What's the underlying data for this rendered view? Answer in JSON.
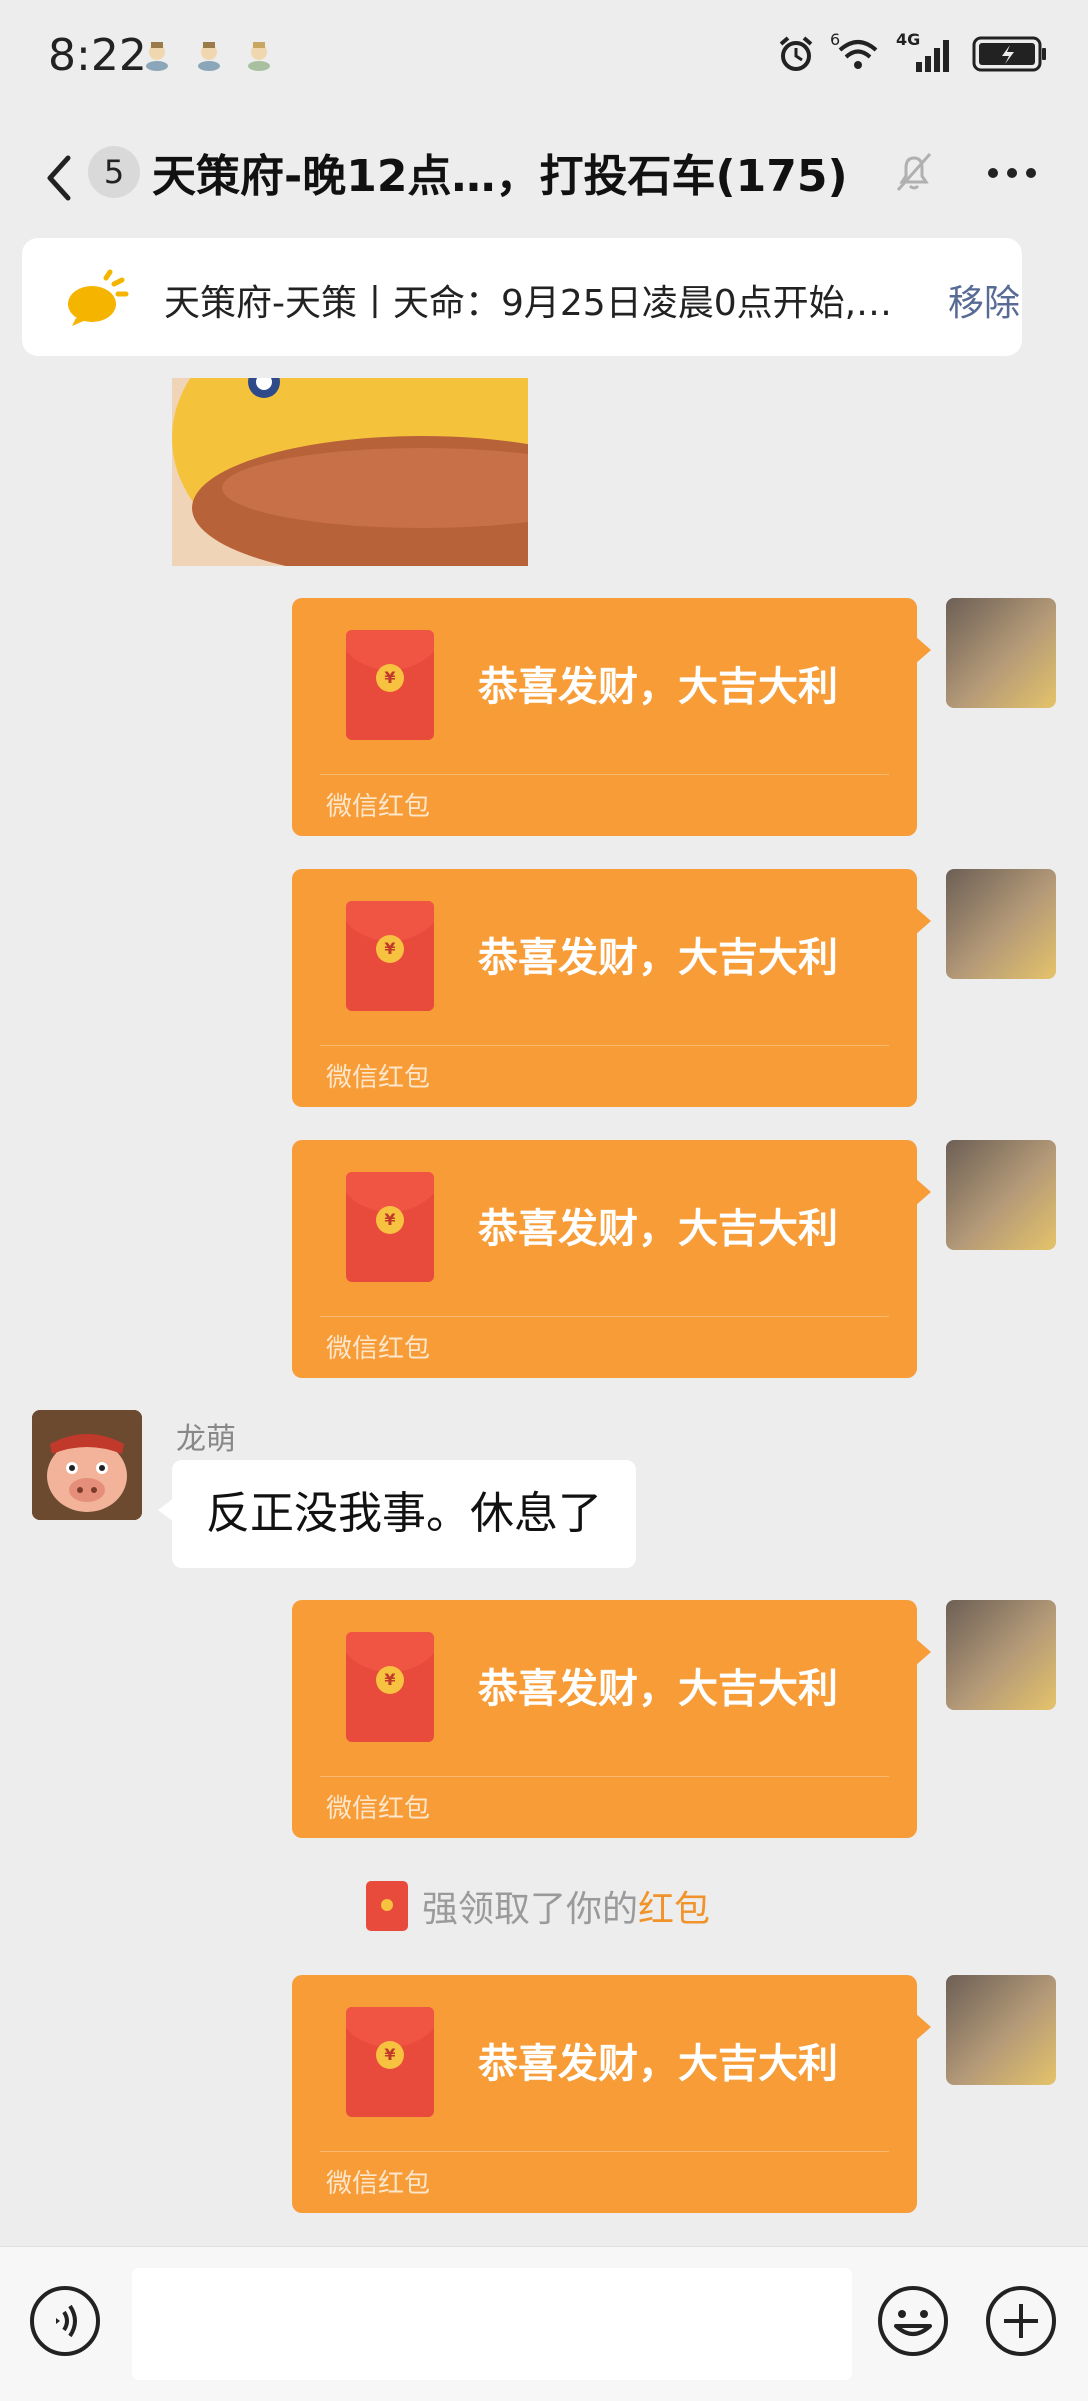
{
  "status_bar": {
    "time": "8:22",
    "network": "4G",
    "sim_slot": "6",
    "icons": [
      "notification-emoji-icon",
      "alarm-icon",
      "wifi-icon",
      "signal-icon",
      "battery-icon"
    ]
  },
  "header": {
    "unread_count": "5",
    "title": "天策府-晚12点…，打投石车(175)",
    "icons": [
      "back-icon",
      "mute-icon",
      "more-icon"
    ]
  },
  "notice": {
    "text": "天策府-天策丨天命：9月25日凌晨0点开始,…",
    "remove_label": "移除"
  },
  "messages": [
    {
      "type": "sticker",
      "from": "other"
    },
    {
      "type": "red_packet",
      "from": "me",
      "title": "恭喜发财，大吉大利",
      "label": "微信红包"
    },
    {
      "type": "red_packet",
      "from": "me",
      "title": "恭喜发财，大吉大利",
      "label": "微信红包"
    },
    {
      "type": "red_packet",
      "from": "me",
      "title": "恭喜发财，大吉大利",
      "label": "微信红包"
    },
    {
      "type": "text",
      "from": "龙萌",
      "sender": "龙萌",
      "text": "反正没我事。休息了"
    },
    {
      "type": "red_packet",
      "from": "me",
      "title": "恭喜发财，大吉大利",
      "label": "微信红包"
    },
    {
      "type": "system",
      "text": "强领取了你的",
      "link": "红包"
    },
    {
      "type": "red_packet",
      "from": "me",
      "title": "恭喜发财，大吉大利",
      "label": "微信红包"
    }
  ],
  "colors": {
    "red_packet": "#f79c37",
    "envelope": "#e84b3c",
    "link": "#576b95",
    "system_link": "#f0932b"
  },
  "input": {
    "value": "",
    "placeholder": ""
  }
}
